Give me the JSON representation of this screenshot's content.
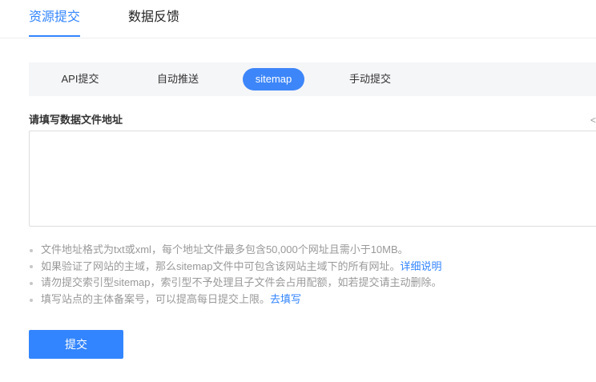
{
  "top_tabs": [
    {
      "label": "资源提交",
      "active": true
    },
    {
      "label": "数据反馈",
      "active": false
    }
  ],
  "sub_tabs": [
    {
      "label": "API提交",
      "active": false
    },
    {
      "label": "自动推送",
      "active": false
    },
    {
      "label": "sitemap",
      "active": true
    },
    {
      "label": "手动提交",
      "active": false
    }
  ],
  "form": {
    "label": "请填写数据文件地址",
    "corner_glyph": "<",
    "textarea_value": ""
  },
  "notes": [
    {
      "text": "文件地址格式为txt或xml，每个地址文件最多包含50,000个网址且需小于10MB。",
      "link": ""
    },
    {
      "text": "如果验证了网站的主域，那么sitemap文件中可包含该网站主域下的所有网址。",
      "link": "详细说明"
    },
    {
      "text": "请勿提交索引型sitemap，索引型不予处理且子文件会占用配额，如若提交请主动删除。",
      "link": ""
    },
    {
      "text": "填写站点的主体备案号，可以提高每日提交上限。",
      "link": "去填写"
    }
  ],
  "submit_label": "提交",
  "colors": {
    "accent": "#3385ff",
    "muted_text": "#999999",
    "subtab_bg": "#f5f6f8"
  }
}
